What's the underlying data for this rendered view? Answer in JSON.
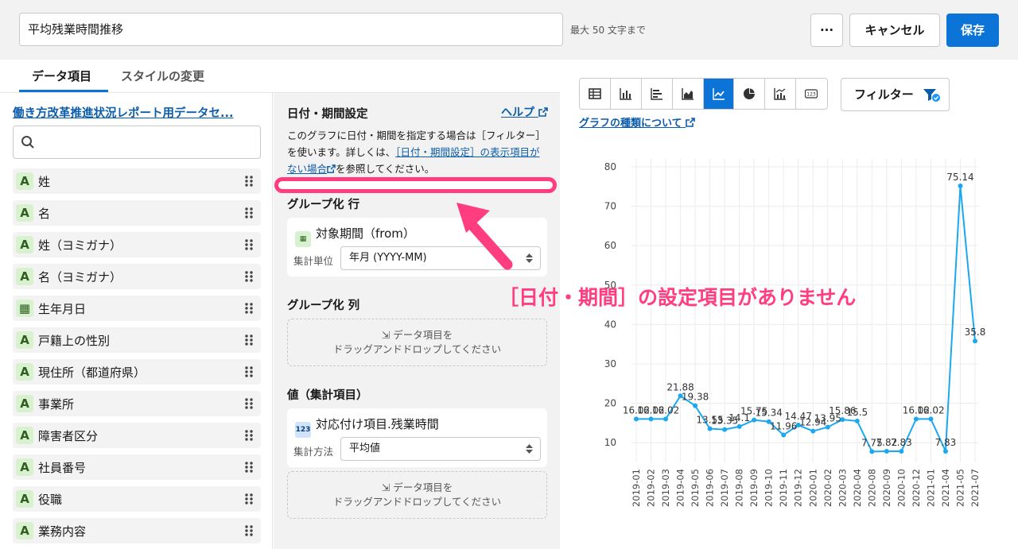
{
  "header": {
    "title_value": "平均残業時間推移",
    "limit_hint": "最大 50 文字まで",
    "more_label": "···",
    "cancel_label": "キャンセル",
    "save_label": "保存"
  },
  "tabs": [
    {
      "label": "データ項目",
      "active": true
    },
    {
      "label": "スタイルの変更",
      "active": false
    }
  ],
  "dataset": {
    "link_label": "働き方改革推進状況レポート用データセ...",
    "search_placeholder": ""
  },
  "fields": [
    {
      "type": "A",
      "label": "姓"
    },
    {
      "type": "A",
      "label": "名"
    },
    {
      "type": "A",
      "label": "姓（ヨミガナ）"
    },
    {
      "type": "A",
      "label": "名（ヨミガナ）"
    },
    {
      "type": "date",
      "label": "生年月日"
    },
    {
      "type": "A",
      "label": "戸籍上の性別"
    },
    {
      "type": "A",
      "label": "現住所（都道府県）"
    },
    {
      "type": "A",
      "label": "事業所"
    },
    {
      "type": "A",
      "label": "障害者区分"
    },
    {
      "type": "A",
      "label": "社員番号"
    },
    {
      "type": "A",
      "label": "役職"
    },
    {
      "type": "A",
      "label": "業務内容"
    }
  ],
  "settings": {
    "date_section": {
      "title": "日付・期間設定",
      "help_label": "ヘルプ",
      "desc_part1": "このグラフに日付・期間を指定する場合は［フィルター］を使います。詳しくは、",
      "desc_link": "［日付・期間設定］の表示項目がない場合",
      "desc_part2": "を参照してください。"
    },
    "group_row": {
      "title": "グループ化 行",
      "item_label": "対象期間（from）",
      "unit_label": "集計単位",
      "unit_value": "年月 (YYYY-MM)"
    },
    "group_col": {
      "title": "グループ化 列",
      "drop_line1": "データ項目を",
      "drop_line2": "ドラッグアンドドロップしてください"
    },
    "values": {
      "title": "値（集計項目）",
      "item_label": "対応付け項目.残業時間",
      "method_label": "集計方法",
      "method_value": "平均値",
      "drop_line1": "データ項目を",
      "drop_line2": "ドラッグアンドドロップしてください"
    }
  },
  "chart_toolbar": {
    "filter_label": "フィルター",
    "about_link": "グラフの種類について",
    "icons": [
      "table-icon",
      "bar-chart-icon",
      "horizontal-bar-icon",
      "area-chart-icon",
      "line-chart-icon",
      "pie-chart-icon",
      "combo-chart-icon",
      "number-icon"
    ],
    "active_index": 4
  },
  "annotation": {
    "text": "［日付・期間］の設定項目がありません",
    "color": "#ff3d7f"
  },
  "chart_data": {
    "type": "line",
    "categories": [
      "2019-01",
      "2019-02",
      "2019-03",
      "2019-04",
      "2019-05",
      "2019-06",
      "2019-07",
      "2019-08",
      "2019-09",
      "2019-10",
      "2019-11",
      "2019-12",
      "2020-01",
      "2020-02",
      "2020-03",
      "2020-04",
      "2020-08",
      "2020-09",
      "2020-10",
      "2020-12",
      "2021-01",
      "2021-04",
      "2021-05",
      "2021-07"
    ],
    "values": [
      16.02,
      16.02,
      16.02,
      21.88,
      19.38,
      13.55,
      13.35,
      14.1,
      15.75,
      15.34,
      11.96,
      14.47,
      12.94,
      13.95,
      15.86,
      15.5,
      7.75,
      7.82,
      7.83,
      16.02,
      16.02,
      7.83,
      75.14,
      35.8
    ],
    "labels": [
      "16.02",
      "16.02",
      "16.02",
      "21.88",
      "19.38",
      "13.55",
      "13.35",
      "14.1",
      "15.75",
      "15.34",
      "11.96",
      "14.47",
      "12.94",
      "13.95",
      "15.86",
      "15.5",
      "7.75",
      "7.82",
      "7.83",
      "16.02",
      "16.02",
      "7.83",
      "75.14",
      "35.8"
    ],
    "yticks": [
      10,
      20,
      30,
      40,
      50,
      60,
      70,
      80
    ],
    "ylim": [
      5,
      82
    ],
    "grid": true,
    "line_color": "#1ba8f0"
  }
}
